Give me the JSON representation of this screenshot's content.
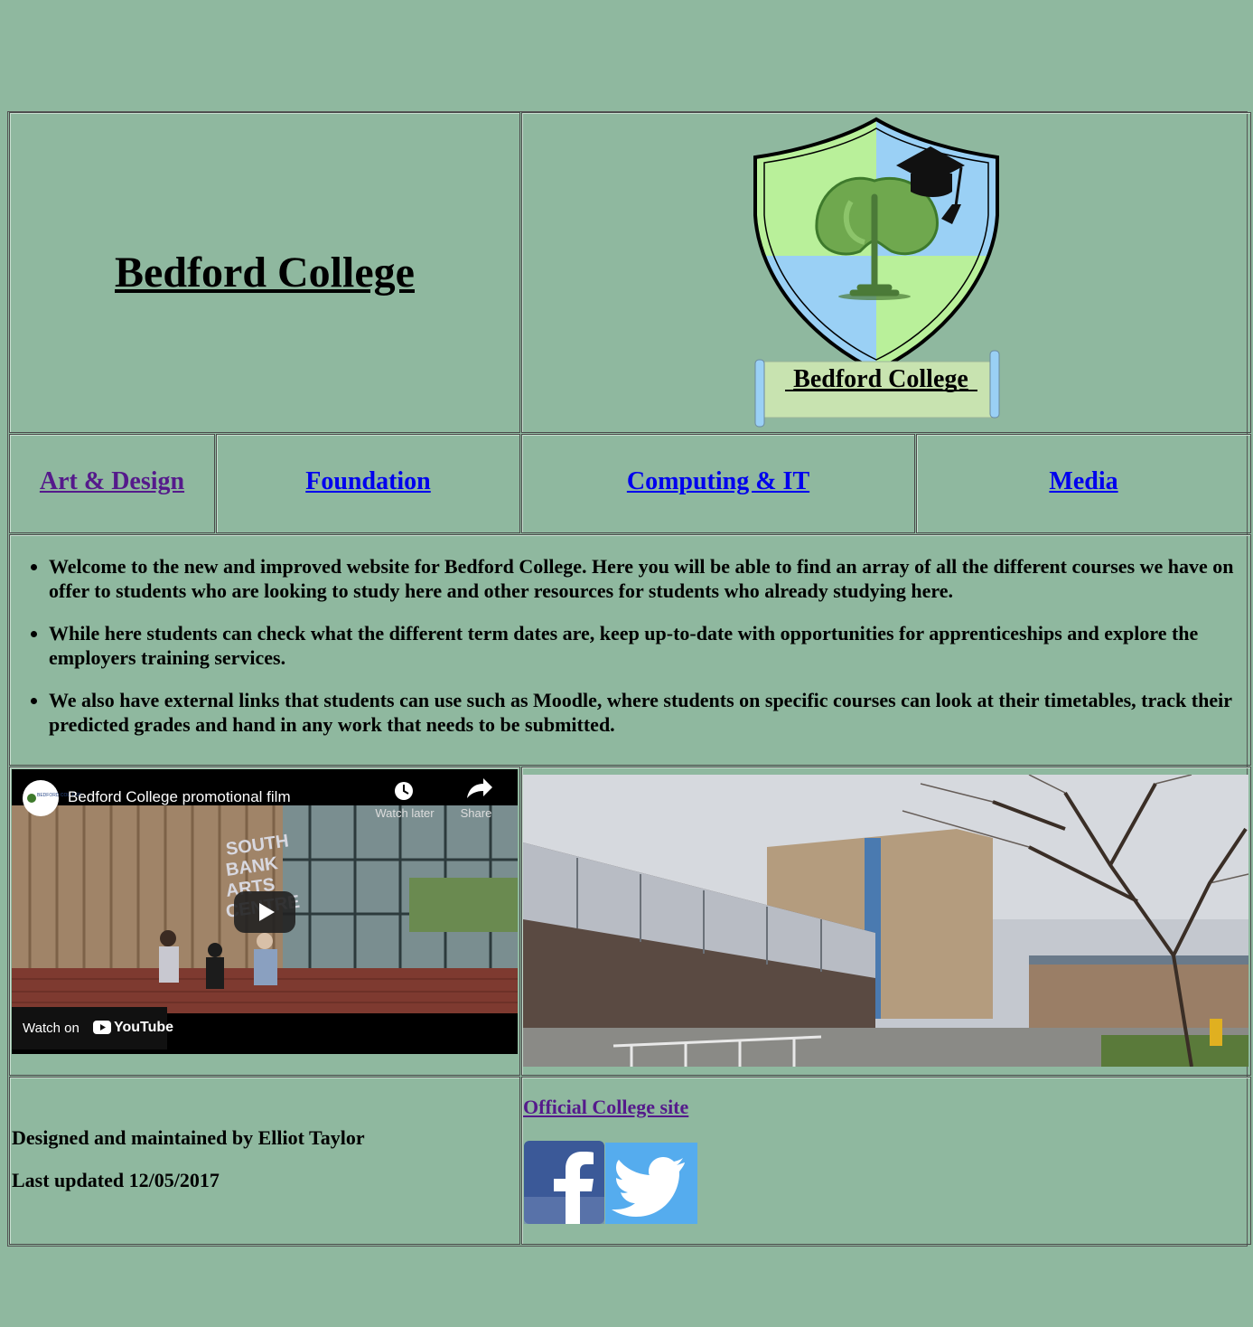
{
  "header": {
    "title": "Bedford College",
    "logo_banner": "Bedford College"
  },
  "nav": [
    {
      "label": "Art & Design",
      "visited": true
    },
    {
      "label": "Foundation",
      "visited": false
    },
    {
      "label": "Computing & IT",
      "visited": false
    },
    {
      "label": "Media",
      "visited": false
    }
  ],
  "intro": [
    "Welcome to the new and improved website for Bedford College. Here you will be able to find an array of all the different courses we have on offer to students who are looking to study here and other resources for students who already studying here.",
    "While here students can check what the different term dates are, keep up-to-date with opportunities for apprenticeships and explore the employers training services.",
    "We also have external links that students can use such as Moodle, where students on specific courses can look at their timetables, track their predicted grades and hand in any work that needs to be submitted."
  ],
  "video": {
    "title": "Bedford College promotional film",
    "watch_later": "Watch later",
    "share": "Share",
    "watch_on": "Watch on",
    "youtube": "YouTube",
    "channel_logo_text": "BEDFORD COLLEGE",
    "scene_sign": "SOUTH BANK ARTS CENTRE"
  },
  "footer": {
    "designed_by": "Designed and maintained by Elliot Taylor",
    "updated": "Last updated 12/05/2017",
    "official_link": "Official College site",
    "social": [
      "facebook",
      "twitter"
    ]
  },
  "colors": {
    "page_bg": "#8fb89f",
    "link": "#0000ee",
    "visited_link": "#551a8b",
    "facebook": "#3b5998",
    "twitter": "#55acee"
  },
  "icons": [
    "play-icon",
    "clock-icon",
    "share-icon",
    "youtube-logo-icon",
    "facebook-icon",
    "twitter-icon"
  ]
}
